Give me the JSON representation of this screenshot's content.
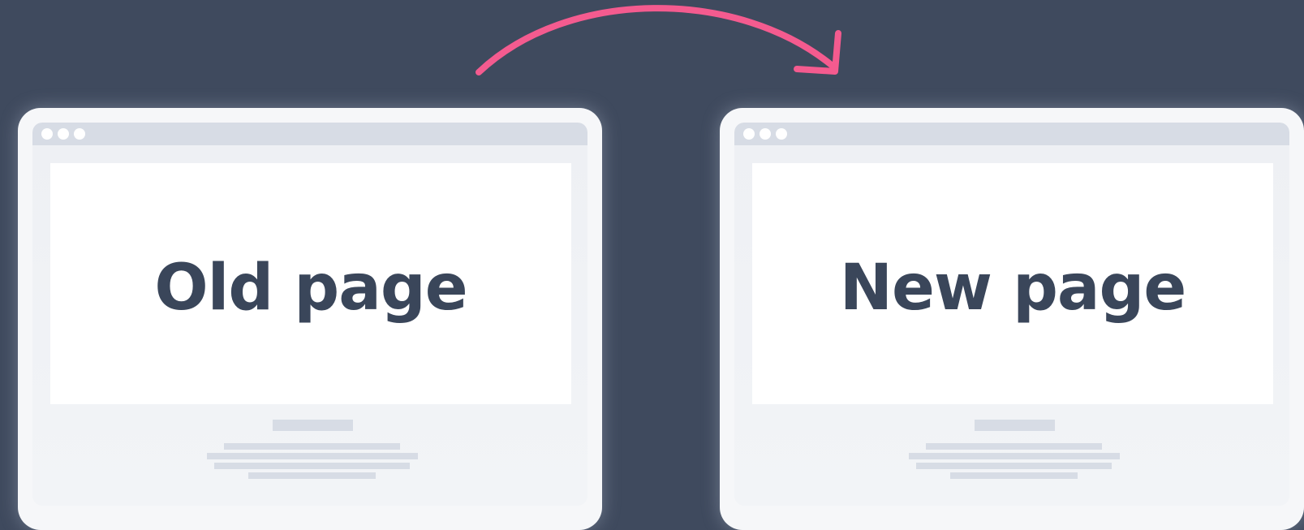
{
  "diagram": {
    "old_page": {
      "label": "Old page"
    },
    "new_page": {
      "label": "New page"
    },
    "arrow": {
      "from": "old_page",
      "to": "new_page",
      "color": "#f45b8f"
    }
  },
  "colors": {
    "background": "#3f4a5e",
    "frame": "#f6f7f9",
    "window_chrome": "#d7dce5",
    "content": "#ffffff",
    "text": "#3a465a",
    "arrow": "#f45b8f"
  }
}
